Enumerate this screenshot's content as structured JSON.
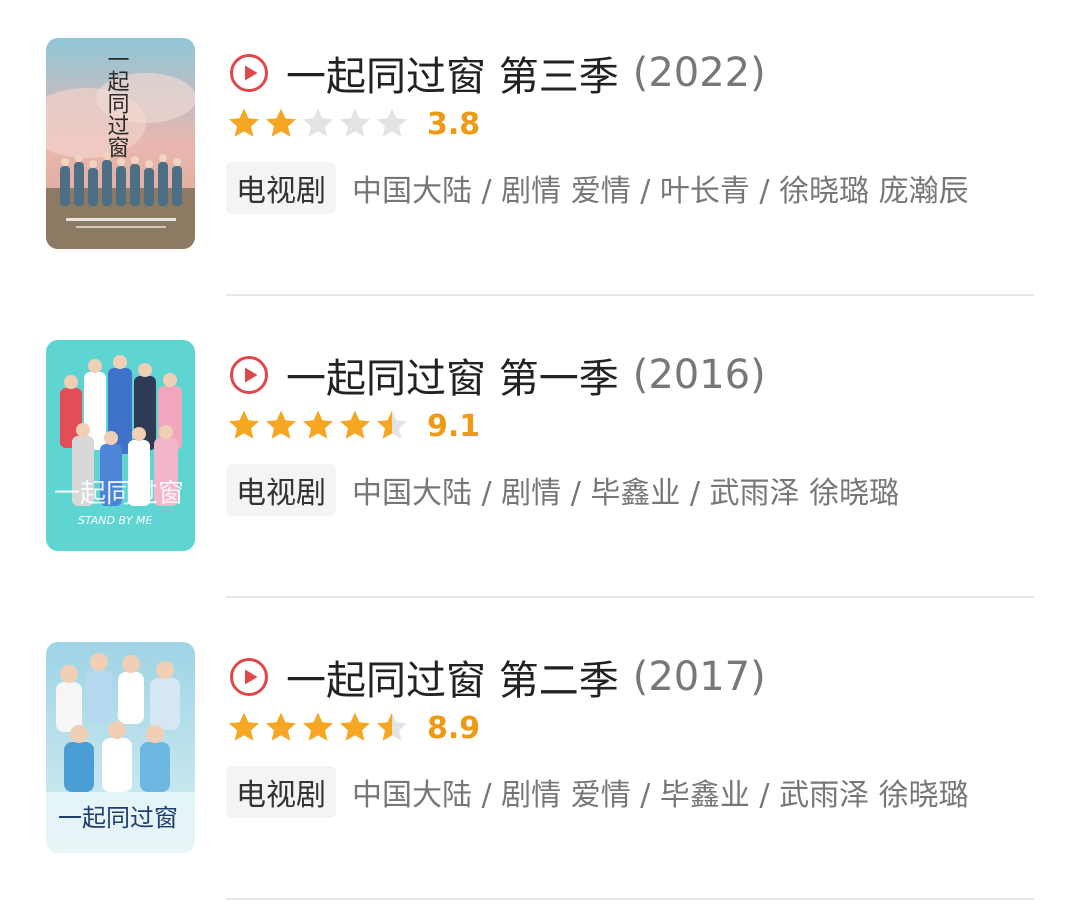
{
  "items": [
    {
      "title": "一起同过窗 第三季",
      "year": "(2022)",
      "rating_value": 3.8,
      "rating_stars": 2.0,
      "score_label": "3.8",
      "tag": "电视剧",
      "meta": "中国大陆 / 剧情 爱情 / 叶长青 / 徐晓璐 庞瀚辰",
      "poster_title": "一起同过窗"
    },
    {
      "title": "一起同过窗 第一季",
      "year": "(2016)",
      "rating_value": 9.1,
      "rating_stars": 4.5,
      "score_label": "9.1",
      "tag": "电视剧",
      "meta": "中国大陆 / 剧情 / 毕鑫业 / 武雨泽 徐晓璐",
      "poster_title": "一起同过窗",
      "poster_subtitle": "STAND BY ME"
    },
    {
      "title": "一起同过窗 第二季",
      "year": "(2017)",
      "rating_value": 8.9,
      "rating_stars": 4.5,
      "score_label": "8.9",
      "tag": "电视剧",
      "meta": "中国大陆 / 剧情 爱情 / 毕鑫业 / 武雨泽 徐晓璐",
      "poster_title": "一起同过窗"
    }
  ],
  "icons": {
    "play": "play-circle-icon",
    "star": "star-icon"
  },
  "colors": {
    "play_icon": "#e04848",
    "star_filled": "#f5a623",
    "star_empty": "#e3e3e3",
    "score": "#ee9a14",
    "tag_bg": "#f4f4f4"
  }
}
